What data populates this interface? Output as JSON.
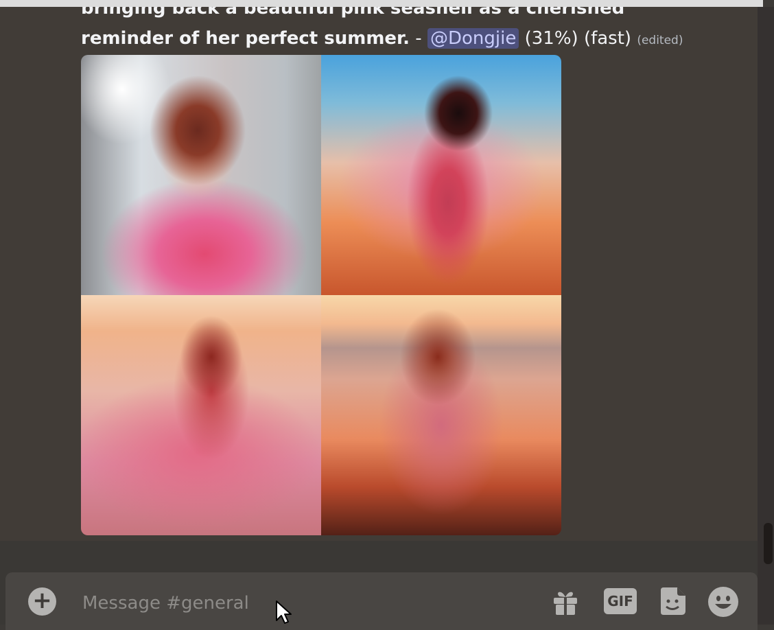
{
  "message": {
    "line1": "bringing back a beautiful pink seashell as a cherished",
    "line2": "reminder of her perfect summer.",
    "separator": " - ",
    "mention": "@Dongjie",
    "progress": "(31%)",
    "mode": "(fast)",
    "edited": "(edited)"
  },
  "composer": {
    "placeholder": "Message #general",
    "plus_label": "+",
    "gif_label": "GIF"
  },
  "icons": {
    "plus": "plus-circle-icon",
    "gift": "gift-icon",
    "gif": "gif-icon",
    "sticker": "sticker-icon",
    "emoji": "emoji-smile-icon",
    "cursor": "mouse-cursor-icon"
  },
  "colors": {
    "chat_bg": "#413c37",
    "mention_bg": "#4d507c",
    "mention_text": "#c9cdfb",
    "composer_bg": "#494643"
  }
}
